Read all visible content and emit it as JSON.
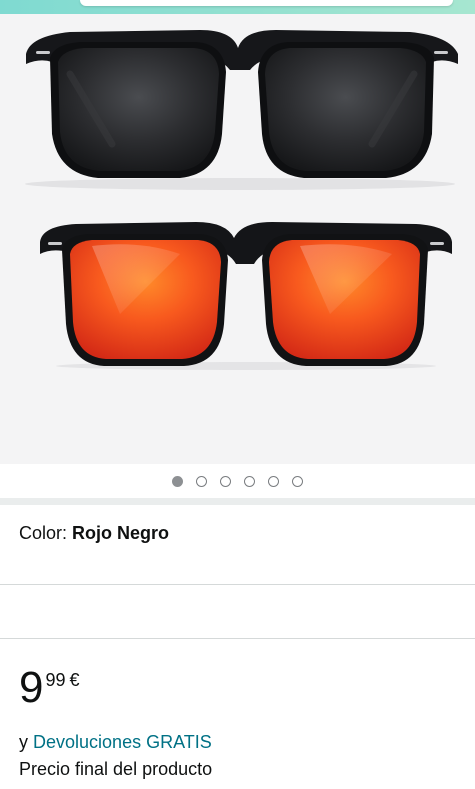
{
  "gallery": {
    "image_count": 6,
    "active_index": 0,
    "image_alt": "sunglasses-product-image"
  },
  "variation": {
    "label": "Color:",
    "value": "Rojo Negro"
  },
  "price": {
    "whole": "9",
    "fraction": "99",
    "currency": "€"
  },
  "returns": {
    "prefix": "y",
    "link": "Devoluciones GRATIS"
  },
  "price_note": "Precio final del producto",
  "colors": {
    "link": "#007185",
    "lens_top": "#2a2b2d",
    "lens_bottom_center": "#ff6a1a",
    "lens_bottom_edge": "#e0321a"
  }
}
